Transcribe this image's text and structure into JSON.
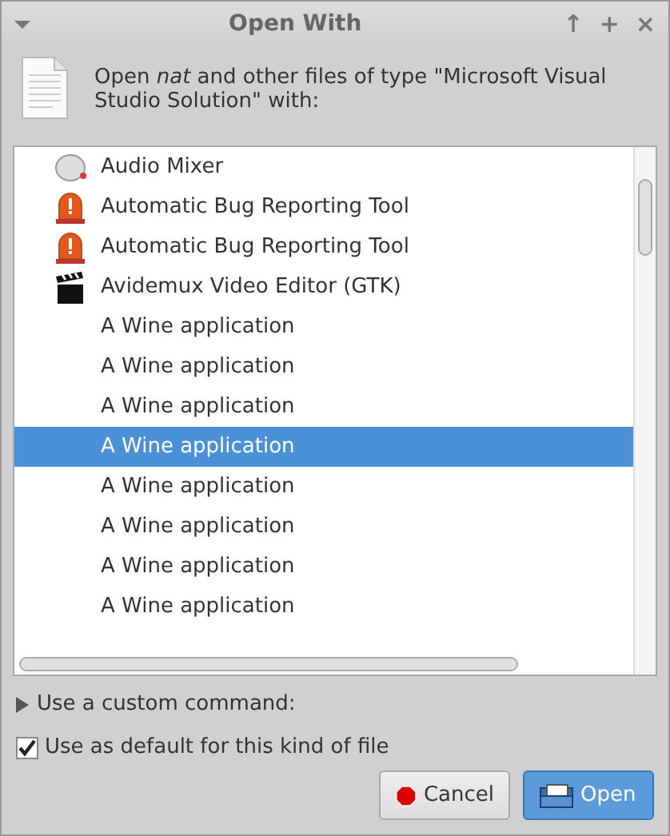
{
  "window": {
    "title": "Open With",
    "controls": [
      "↑",
      "+",
      "×"
    ]
  },
  "header": {
    "text": "Open *nat* and other files of type \"Microsoft Visual Studio Solution\" with:"
  },
  "apps": [
    {
      "name": "Audio Mixer",
      "kind": "mixer",
      "selected": false
    },
    {
      "name": "Automatic Bug Reporting Tool",
      "kind": "alarm",
      "selected": false
    },
    {
      "name": "Automatic Bug Reporting Tool",
      "kind": "alarm",
      "selected": false
    },
    {
      "name": "Avidemux Video Editor (GTK)",
      "kind": "clapper",
      "selected": false
    },
    {
      "name": "A Wine application",
      "selected": false
    },
    {
      "name": "A Wine application",
      "selected": false
    },
    {
      "name": "A Wine application",
      "selected": false
    },
    {
      "name": "A Wine application",
      "selected": true
    },
    {
      "name": "A Wine application",
      "selected": false
    },
    {
      "name": "A Wine application",
      "selected": false
    },
    {
      "name": "A Wine application",
      "selected": false
    },
    {
      "name": "A Wine application",
      "selected": false
    }
  ],
  "custom_command": {
    "label": "Use a custom command:",
    "expanded": false
  },
  "default_option": {
    "label": "Use as default for this kind of file",
    "checked": true
  },
  "buttons": [
    {
      "label": "Cancel",
      "kind": "cancel"
    },
    {
      "label": "Open",
      "kind": "open"
    }
  ]
}
